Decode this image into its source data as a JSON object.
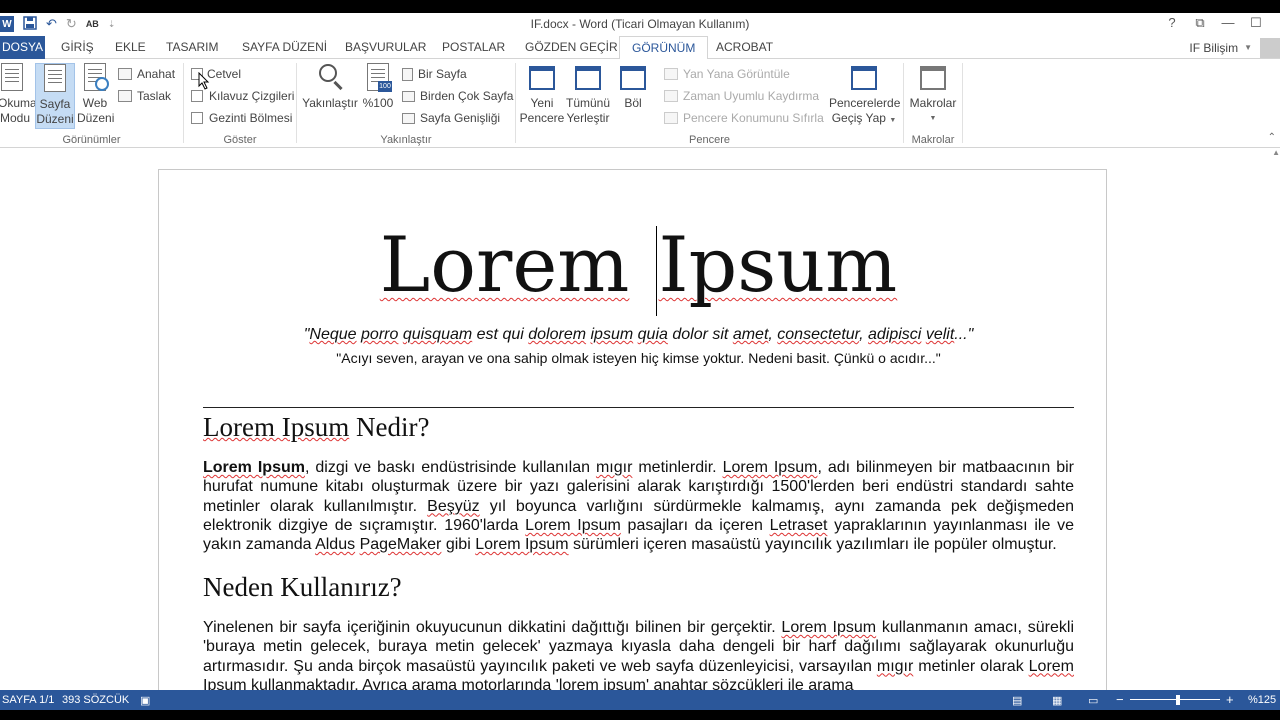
{
  "titlebar": {
    "app_logo": "W",
    "title": "IF.docx - Word (Ticari Olmayan Kullanım)",
    "quick_access": [
      "save-icon",
      "undo-icon",
      "redo-icon",
      "spelling-icon",
      "customize-icon"
    ],
    "spelling_label": "AB",
    "window_controls": {
      "help": "?",
      "ribbon_display": "⧉",
      "minimize": "—",
      "maximize": "☐"
    }
  },
  "tabs": {
    "file": "DOSYA",
    "items": [
      "GİRİŞ",
      "EKLE",
      "TASARIM",
      "SAYFA DÜZENİ",
      "BAŞVURULAR",
      "POSTALAR",
      "GÖZDEN GEÇİR",
      "GÖRÜNÜM",
      "ACROBAT"
    ],
    "active": "GÖRÜNÜM",
    "account": "IF Bilişim"
  },
  "ribbon": {
    "views": {
      "label": "Görünümler",
      "okuma": [
        "Okuma",
        "Modu"
      ],
      "sayfa": [
        "Sayfa",
        "Düzeni"
      ],
      "web": [
        "Web",
        "Düzeni"
      ],
      "anahat": "Anahat",
      "taslak": "Taslak"
    },
    "show": {
      "label": "Göster",
      "cetvel": "Cetvel",
      "kilavuz": "Kılavuz Çizgileri",
      "gezinti": "Gezinti Bölmesi"
    },
    "zoom": {
      "label": "Yakınlaştır",
      "zoom_btn": "Yakınlaştır",
      "pct100": "%100",
      "one_page": "Bir Sayfa",
      "multi_page": "Birden Çok Sayfa",
      "page_width": "Sayfa Genişliği"
    },
    "window": {
      "label": "Pencere",
      "new_window": [
        "Yeni",
        "Pencere"
      ],
      "arrange_all": [
        "Tümünü",
        "Yerleştir"
      ],
      "split": "Böl",
      "side_by_side": "Yan Yana Görüntüle",
      "sync_scroll": "Zaman Uyumlu Kaydırma",
      "reset_pos": "Pencere Konumunu Sıfırla",
      "switch": [
        "Pencerelerde",
        "Geçiş Yap"
      ]
    },
    "macros": {
      "label": "Makrolar",
      "btn": "Makrolar"
    }
  },
  "document": {
    "title_a": "Lorem",
    "title_b": "Ipsum",
    "quote_parts": [
      "\"",
      "Neque",
      " ",
      "porro",
      " ",
      "quisquam",
      " est qui ",
      "dolorem",
      " ",
      "ipsum",
      " ",
      "quia",
      " dolor sit ",
      "amet",
      ", ",
      "consectetur",
      ", ",
      "adipisci",
      " ",
      "velit",
      "...\""
    ],
    "quote2": "\"Acıyı seven, arayan ve ona sahip olmak isteyen hiç kimse yoktur. Nedeni basit. Çünkü o acıdır...\"",
    "h1_a": "Lorem Ipsum",
    "h1_b": " Nedir?",
    "p1": {
      "bold": "Lorem Ipsum",
      "t1": ", dizgi ve baskı endüstrisinde kullanılan ",
      "u1": "mıgır",
      "t2": " metinlerdir. ",
      "u2": "Lorem Ipsum",
      "t3": ", adı bilinmeyen bir matbaacının bir hurufat numune kitabı oluşturmak üzere bir yazı galerisini alarak karıştırdığı 1500'lerden beri endüstri standardı sahte metinler olarak kullanılmıştır. ",
      "u3": "Beşyüz",
      "t4": " yıl boyunca varlığını sürdürmekle kalmamış, aynı zamanda pek değişmeden elektronik dizgiye de sıçramıştır. 1960'larda ",
      "u4": "Lorem Ipsum",
      "t5": " pasajları da içeren ",
      "u5": "Letraset",
      "t6": " yapraklarının yayınlanması ile ve yakın zamanda ",
      "u6": "Aldus",
      "t7": " ",
      "u7": "PageMaker",
      "t8": " gibi ",
      "u8": "Lorem Ipsum",
      "t9": " sürümleri içeren masaüstü yayıncılık yazılımları ile popüler olmuştur."
    },
    "h2": "Neden Kullanırız?",
    "p2": {
      "t1": "Yinelenen bir sayfa içeriğinin okuyucunun dikkatini dağıttığı bilinen bir gerçektir. ",
      "u1": "Lorem Ipsum",
      "t2": " kullanmanın amacı, sürekli 'buraya metin gelecek, buraya metin gelecek' yazmaya kıyasla daha dengeli bir harf dağılımı sağlayarak okunurluğu artırmasıdır. Şu anda birçok masaüstü yayıncılık paketi ve web sayfa düzenleyicisi, varsayılan ",
      "u2": "mıgır",
      "t3": " metinler olarak ",
      "u3": "Lorem Ipsum",
      "t4": " kullanmaktadır. Ayrıca arama motorlarında '",
      "u4": "lorem ipsum",
      "t5": "' anahtar sözcükleri ile arama"
    }
  },
  "status": {
    "page": "SAYFA 1/1",
    "words": "393 SÖZCÜK",
    "zoom": "%125",
    "zoom_out": "−",
    "zoom_in": "+"
  }
}
